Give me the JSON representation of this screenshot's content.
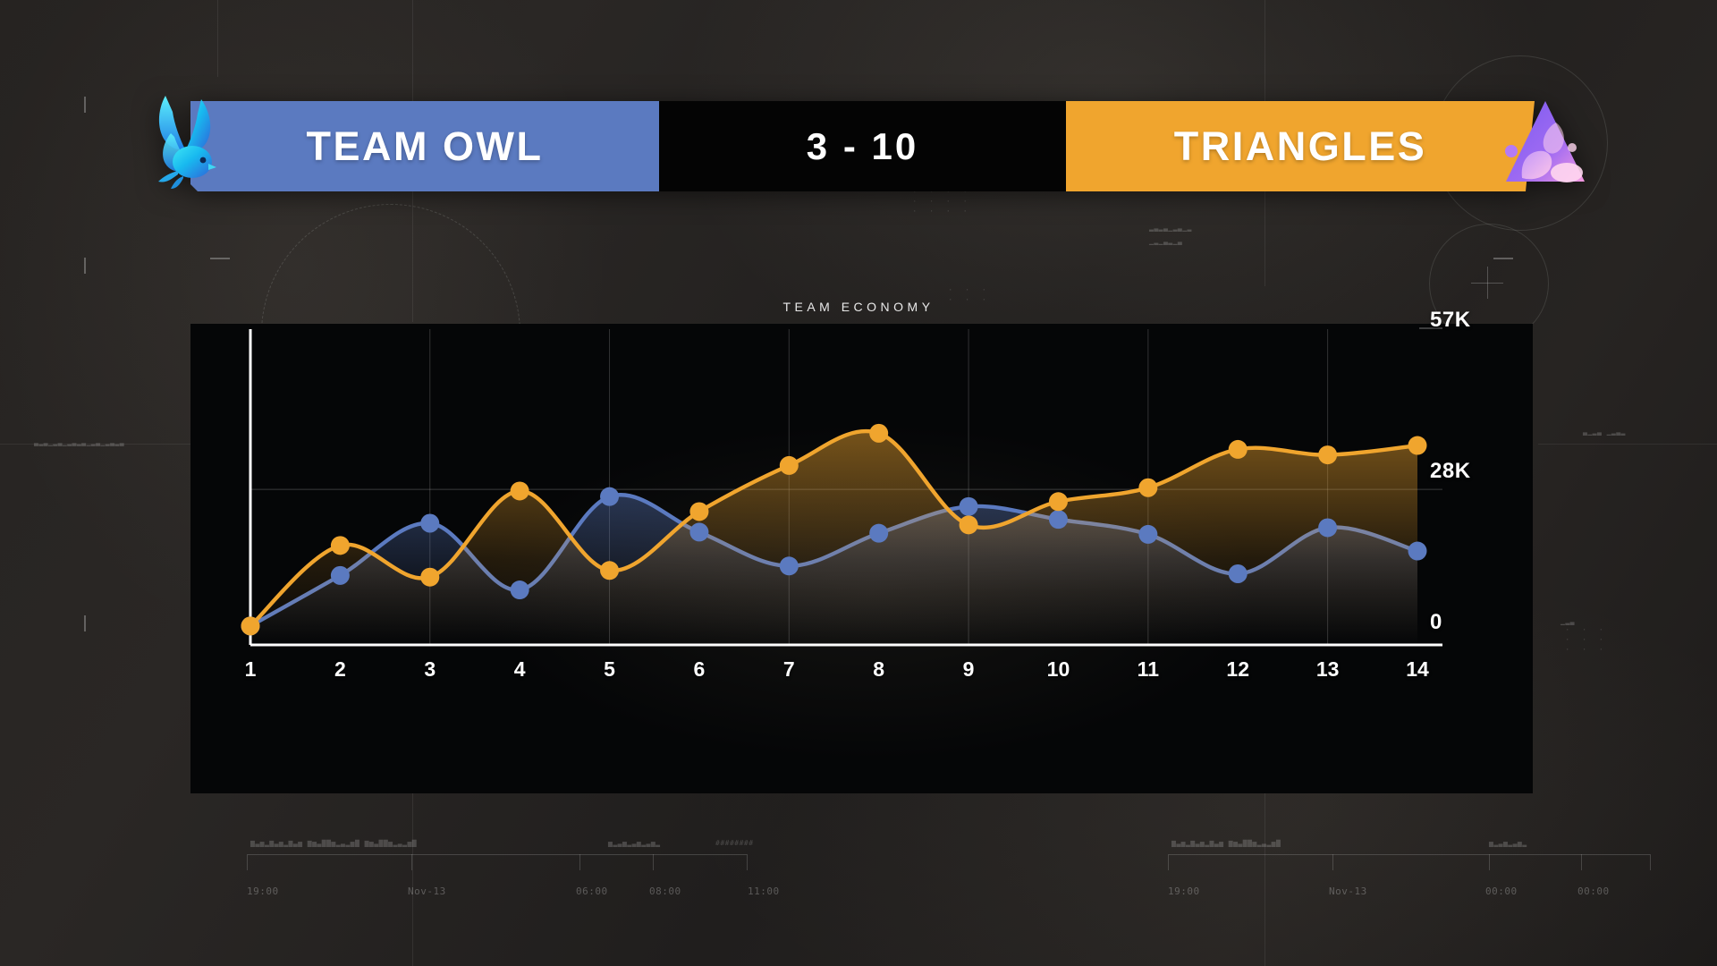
{
  "scoreboard": {
    "left_team": {
      "name": "TEAM OWL",
      "color": "#5b7ac0",
      "logo_icon": "owl-logo-icon"
    },
    "right_team": {
      "name": "TRIANGLES",
      "color": "#f0a52e",
      "logo_icon": "triangle-logo-icon"
    },
    "score": "3 - 10",
    "score_left": "3",
    "score_right": "10",
    "score_panel_color": "#040404"
  },
  "chart_title": "TEAM ECONOMY",
  "chart_data": {
    "type": "line",
    "title": "TEAM ECONOMY",
    "xlabel": "",
    "ylabel": "",
    "x": [
      1,
      2,
      3,
      4,
      5,
      6,
      7,
      8,
      9,
      10,
      11,
      12,
      13,
      14
    ],
    "categories": [
      "1",
      "2",
      "3",
      "4",
      "5",
      "6",
      "7",
      "8",
      "9",
      "10",
      "11",
      "12",
      "13",
      "14"
    ],
    "ylim": [
      0,
      57000
    ],
    "ytick_labels": [
      "0",
      "28K",
      "57K"
    ],
    "ytick_values": [
      0,
      28000,
      57000
    ],
    "grid": true,
    "legend": "none",
    "series": [
      {
        "name": "TEAM OWL",
        "color": "#5b7ac0",
        "values": [
          3400,
          12500,
          21900,
          9900,
          26700,
          20300,
          14200,
          20100,
          24900,
          22600,
          19900,
          12800,
          21100,
          16900
        ]
      },
      {
        "name": "TRIANGLES",
        "color": "#f0a52e",
        "values": [
          3400,
          17900,
          12200,
          27700,
          13400,
          24000,
          32300,
          38100,
          21600,
          25800,
          28300,
          35200,
          34200,
          35900
        ]
      }
    ]
  },
  "background_hud": {
    "timeline_labels": [
      "19:00",
      "Nov-13",
      "06:00",
      "08:00",
      "11:00",
      "19:00",
      "Nov-13",
      "00:00",
      "00:00"
    ],
    "micro_text": "########"
  }
}
